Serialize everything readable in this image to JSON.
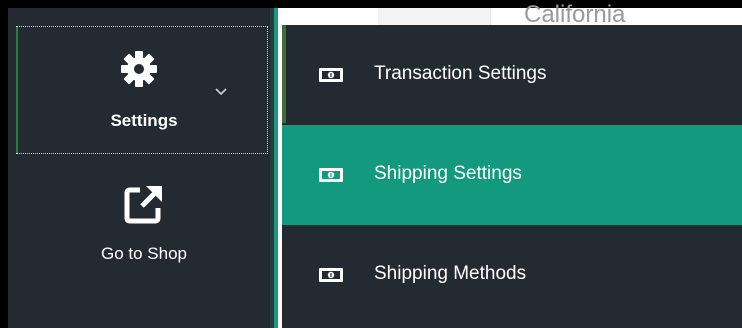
{
  "sidebar": {
    "settings_label": "Settings",
    "shop_label": "Go to Shop"
  },
  "background": {
    "partial_text": "California"
  },
  "submenu": {
    "items": [
      {
        "label": "Transaction Settings",
        "icon": "money-icon",
        "active": false
      },
      {
        "label": "Shipping Settings",
        "icon": "money-icon",
        "active": true
      },
      {
        "label": "Shipping Methods",
        "icon": "money-icon",
        "active": false
      }
    ]
  },
  "colors": {
    "sidebar_bg": "#242a31",
    "active_item_bg": "#139a7e",
    "accent_green": "#2a7d3a"
  }
}
